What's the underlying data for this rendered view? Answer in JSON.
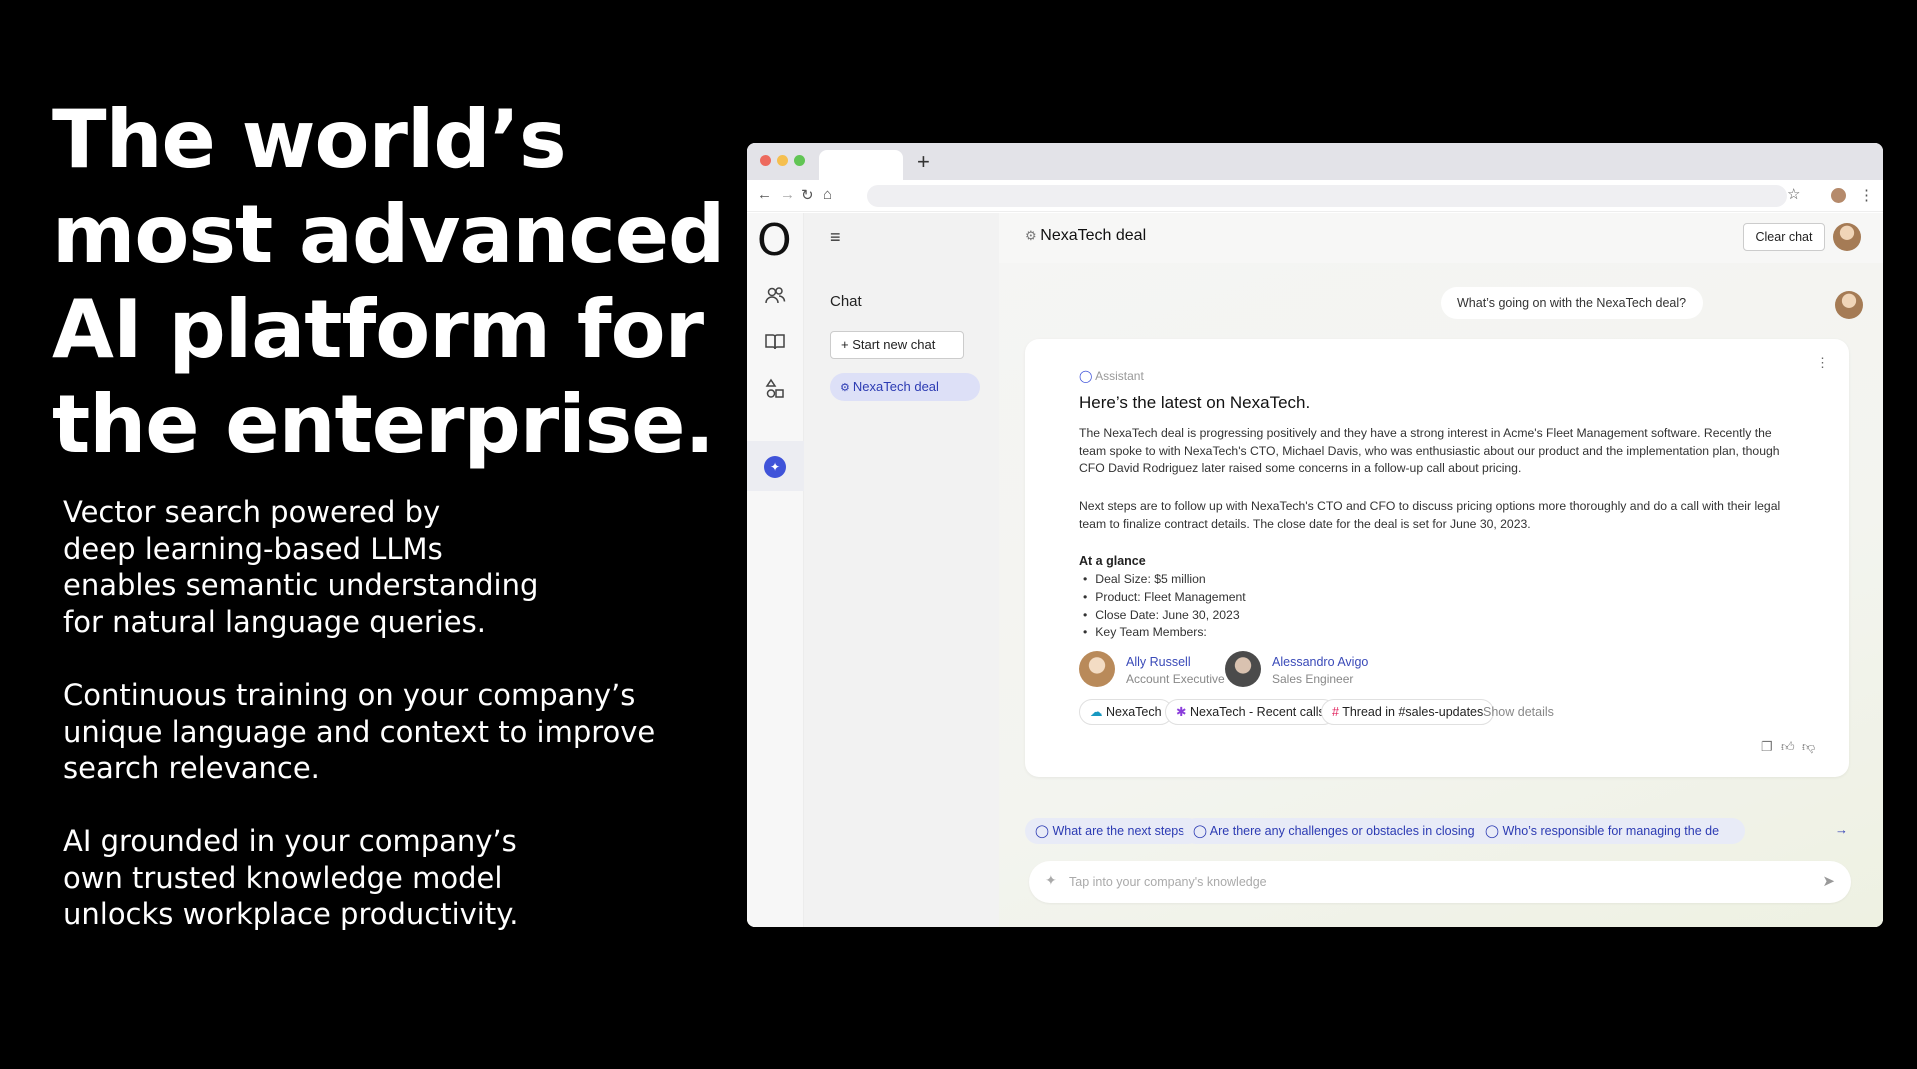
{
  "headline": [
    "The world’s",
    "most advanced",
    "AI platform for",
    "the enterprise."
  ],
  "copy": [
    [
      "Vector search powered by",
      "deep learning-based LLMs",
      "enables semantic understanding",
      "for natural language queries."
    ],
    [
      "Continuous training on your company’s",
      "unique language and context to improve",
      "search relevance."
    ],
    [
      "AI grounded in your company’s",
      "own trusted knowledge model",
      "unlocks workplace productivity."
    ]
  ],
  "browser": {
    "new_tab_icon": "+",
    "nav_icons": [
      "back-icon",
      "forward-icon",
      "reload-icon",
      "home-icon"
    ]
  },
  "sidebar": {
    "chat_heading": "Chat",
    "start_new_chat": "Start new chat",
    "conversations": [
      "NexaTech deal"
    ]
  },
  "header": {
    "title": "NexaTech deal",
    "clear_chat": "Clear chat"
  },
  "user_message": "What’s going on with the NexaTech deal?",
  "assistant": {
    "label": "Assistant",
    "title": "Here’s the latest on NexaTech.",
    "para1": "The NexaTech deal is progressing positively and they have a strong interest in Acme's Fleet Management software. Recently the team spoke to with NexaTech's CTO, Michael Davis, who was enthusiastic about our product and the implementation plan, though CFO David Rodriguez later raised some concerns in a follow-up call about pricing.",
    "para2": "Next steps are to follow up with NexaTech's CTO and CFO to discuss pricing options more thoroughly and do a call with their legal team to finalize contract details. The close date for the deal is set for June 30, 2023.",
    "glance_heading": "At a glance",
    "glance": [
      "Deal Size: $5 million",
      "Product: Fleet Management",
      "Close Date: June 30, 2023",
      "Key Team Members:"
    ],
    "people": [
      {
        "name": "Ally Russell",
        "role": "Account Executive"
      },
      {
        "name": "Alessandro Avigo",
        "role": "Sales Engineer"
      }
    ],
    "sources": [
      "NexaTech",
      "NexaTech - Recent calls",
      "Thread in #sales-updates"
    ],
    "show_details": "Show details"
  },
  "suggestions": [
    "What are the next steps?",
    "Are there any challenges or obstacles in closing this?",
    "Who’s responsible for managing the de"
  ],
  "input": {
    "placeholder": "Tap into your company's knowledge"
  },
  "colors": {
    "accent": "#3f53d9",
    "link": "#3a4ab8"
  }
}
